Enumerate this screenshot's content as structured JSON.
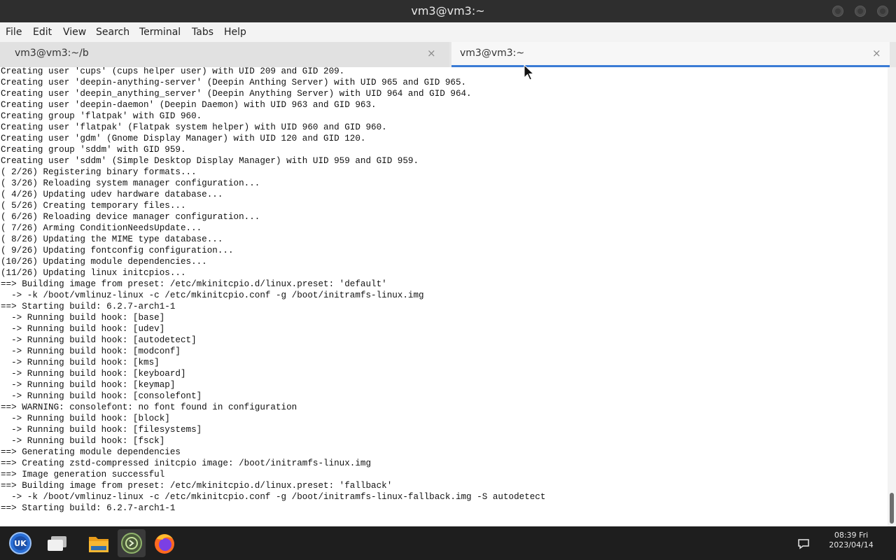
{
  "window": {
    "title": "vm3@vm3:~"
  },
  "menu": [
    "File",
    "Edit",
    "View",
    "Search",
    "Terminal",
    "Tabs",
    "Help"
  ],
  "tabs": [
    {
      "label": "vm3@vm3:~/b",
      "close": "×",
      "active": false
    },
    {
      "label": "vm3@vm3:~",
      "close": "×",
      "active": true
    }
  ],
  "terminal": {
    "lines": [
      "Creating user 'cups' (cups helper user) with UID 209 and GID 209.",
      "Creating user 'deepin-anything-server' (Deepin Anthing Server) with UID 965 and GID 965.",
      "Creating user 'deepin_anything_server' (Deepin Anything Server) with UID 964 and GID 964.",
      "Creating user 'deepin-daemon' (Deepin Daemon) with UID 963 and GID 963.",
      "Creating group 'flatpak' with GID 960.",
      "Creating user 'flatpak' (Flatpak system helper) with UID 960 and GID 960.",
      "Creating user 'gdm' (Gnome Display Manager) with UID 120 and GID 120.",
      "Creating group 'sddm' with GID 959.",
      "Creating user 'sddm' (Simple Desktop Display Manager) with UID 959 and GID 959.",
      "( 2/26) Registering binary formats...",
      "( 3/26) Reloading system manager configuration...",
      "( 4/26) Updating udev hardware database...",
      "( 5/26) Creating temporary files...",
      "( 6/26) Reloading device manager configuration...",
      "( 7/26) Arming ConditionNeedsUpdate...",
      "( 8/26) Updating the MIME type database...",
      "( 9/26) Updating fontconfig configuration...",
      "(10/26) Updating module dependencies...",
      "(11/26) Updating linux initcpios...",
      "==> Building image from preset: /etc/mkinitcpio.d/linux.preset: 'default'",
      "  -> -k /boot/vmlinuz-linux -c /etc/mkinitcpio.conf -g /boot/initramfs-linux.img",
      "==> Starting build: 6.2.7-arch1-1",
      "  -> Running build hook: [base]",
      "  -> Running build hook: [udev]",
      "  -> Running build hook: [autodetect]",
      "  -> Running build hook: [modconf]",
      "  -> Running build hook: [kms]",
      "  -> Running build hook: [keyboard]",
      "  -> Running build hook: [keymap]",
      "  -> Running build hook: [consolefont]",
      "==> WARNING: consolefont: no font found in configuration",
      "  -> Running build hook: [block]",
      "  -> Running build hook: [filesystems]",
      "  -> Running build hook: [fsck]",
      "==> Generating module dependencies",
      "==> Creating zstd-compressed initcpio image: /boot/initramfs-linux.img",
      "==> Image generation successful",
      "==> Building image from preset: /etc/mkinitcpio.d/linux.preset: 'fallback'",
      "  -> -k /boot/vmlinuz-linux -c /etc/mkinitcpio.conf -g /boot/initramfs-linux-fallback.img -S autodetect",
      "==> Starting build: 6.2.7-arch1-1"
    ]
  },
  "taskbar": {
    "items": [
      {
        "icon": "launcher-icon"
      },
      {
        "icon": "multitasking-view-icon"
      },
      {
        "icon": "file-manager-icon"
      },
      {
        "icon": "terminal-icon",
        "active": true
      },
      {
        "icon": "firefox-icon"
      }
    ],
    "clock": {
      "time": "08:39 Fri",
      "date": "2023/04/14"
    },
    "notification_icon": "notification-icon"
  }
}
